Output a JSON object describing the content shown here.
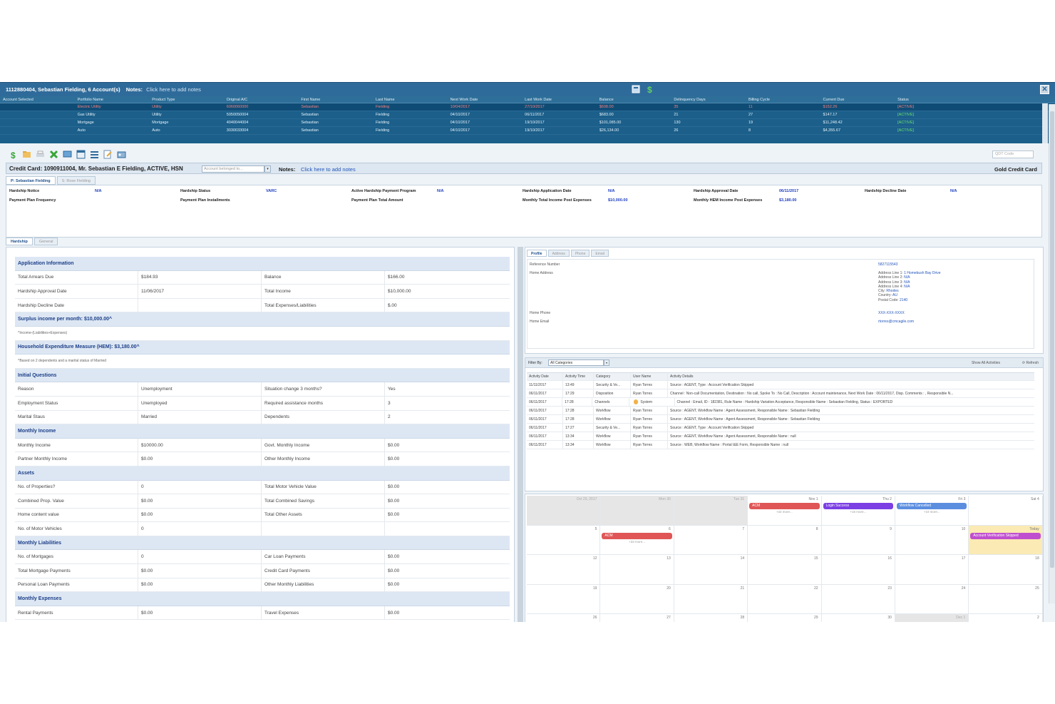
{
  "topbar": {
    "account": "1112880404, Sebastian Fielding, 6 Account(s)",
    "notes_label": "Notes:",
    "notes_link": "Click here to add notes",
    "close": "✕"
  },
  "accounts": {
    "headers": [
      "Account Selected",
      "Portfolio Name",
      "Product Type",
      "Original A/C",
      "First Name",
      "Last Name",
      "Next Work Date",
      "Last Work Date",
      "Balance",
      "Delinquency Days",
      "Billing Cycle",
      "Current Due",
      "Status"
    ],
    "rows": [
      [
        "",
        "Electric Utility",
        "Utility",
        "6060060000",
        "Sebastian",
        "Fielding",
        "10/04/2017",
        "27/10/2017",
        "$608.00",
        "35",
        "11",
        "$152.26",
        "[ACTIVE]"
      ],
      [
        "",
        "Gas Utility",
        "Utility",
        "5050050004",
        "Sebastian",
        "Fielding",
        "04/10/2017",
        "06/11/2017",
        "$683.00",
        "21",
        "27",
        "$147.17",
        "[ACTIVE]"
      ],
      [
        "",
        "Mortgage",
        "Mortgage",
        "4040044004",
        "Sebastian",
        "Fielding",
        "04/10/2017",
        "19/10/2017",
        "$101,085.00",
        "130",
        "19",
        "$11,248.42",
        "[ACTIVE]"
      ],
      [
        "",
        "Auto",
        "Auto",
        "3030033004",
        "Sebastian",
        "Fielding",
        "04/10/2017",
        "19/10/2017",
        "$26,134.00",
        "26",
        "8",
        "$4,355.67",
        "[ACTIVE]"
      ]
    ]
  },
  "toolbar": {
    "qdt_placeholder": "QDT Code"
  },
  "ccbar": {
    "title": "Credit Card: 1090911004, Mr. Sebastian E Fielding, ACTIVE, HSN",
    "dropdown": "Account belonged to...",
    "notes_label": "Notes:",
    "notes_link": "Click here to add notes",
    "card_type": "Gold Credit Card"
  },
  "person_tabs": [
    "P: Sebastian Fielding",
    "S: Rose Fielding"
  ],
  "hardship_summary": [
    {
      "k": "Hardship Notice",
      "v": "N/A"
    },
    {
      "k": "Hardship Status",
      "v": "VARC"
    },
    {
      "k": "Active Hardship Payment Program",
      "v": "N/A"
    },
    {
      "k": "Hardship Application Date",
      "v": "N/A"
    },
    {
      "k": "Hardship Approval Date",
      "v": "06/11/2017"
    },
    {
      "k": "Hardship Decline Date",
      "v": "N/A"
    },
    {
      "k": "Payment Plan Frequency",
      "v": ""
    },
    {
      "k": "Payment Plan Installments",
      "v": ""
    },
    {
      "k": "Payment Plan Total Amount",
      "v": ""
    },
    {
      "k": "Monthly Total Income Post Expenses",
      "v": "$10,000.00"
    },
    {
      "k": "Monthly HEM Income Post Expenses",
      "v": "$3,180.00"
    },
    {
      "k": "",
      "v": ""
    }
  ],
  "lower_tabs": [
    "Hardship",
    "General"
  ],
  "application": {
    "rows": [
      {
        "type": "section",
        "text": "Application Information"
      },
      {
        "type": "row",
        "cells": [
          "Total Arrears Due",
          "$184.93",
          "Balance",
          "$166.00"
        ]
      },
      {
        "type": "row",
        "cells": [
          "Hardship Approval Date",
          "11/06/2017",
          "Total Income",
          "$10,000.00"
        ]
      },
      {
        "type": "row",
        "cells": [
          "Hardship Decline Date",
          "",
          "Total Expenses/Liabilities",
          "$.00"
        ]
      },
      {
        "type": "section",
        "text": "Surplus income per month: $10,000.00^"
      },
      {
        "type": "note",
        "text": "^Income-(Liabilities+Expenses)"
      },
      {
        "type": "section",
        "text": "Household Expenditure Measure (HEM): $3,180.00^"
      },
      {
        "type": "note",
        "text": "^Based on 2 dependents and a marital status of Married"
      },
      {
        "type": "section",
        "text": "Initial Questions"
      },
      {
        "type": "row",
        "cells": [
          "Reason",
          "Unemployment",
          "Situation change 3 months?",
          "Yes"
        ]
      },
      {
        "type": "row",
        "cells": [
          "Employment Status",
          "Unemployed",
          "Required assistance months",
          "3"
        ]
      },
      {
        "type": "row",
        "cells": [
          "Marital Staus",
          "Married",
          "Dependents",
          "2"
        ]
      },
      {
        "type": "section",
        "text": "Monthly Income"
      },
      {
        "type": "row",
        "cells": [
          "Monthly Income",
          "$10000.00",
          "Govt. Monthly Income",
          "$0.00"
        ]
      },
      {
        "type": "row",
        "cells": [
          "Partner Monthly Income",
          "$0.00",
          "Other Monthly Income",
          "$0.00"
        ]
      },
      {
        "type": "section",
        "text": "Assets"
      },
      {
        "type": "row",
        "cells": [
          "No. of Properties?",
          "0",
          "Total Motor Vehicle Value",
          "$0.00"
        ]
      },
      {
        "type": "row",
        "cells": [
          "Combined Prop. Value",
          "$0.00",
          "Total Combined Savings",
          "$0.00"
        ]
      },
      {
        "type": "row",
        "cells": [
          "Home content value",
          "$0.00",
          "Total Other Assets",
          "$0.00"
        ]
      },
      {
        "type": "row",
        "cells": [
          "No. of Motor Vehicles",
          "0",
          "",
          ""
        ]
      },
      {
        "type": "section",
        "text": "Monthly Liabilities"
      },
      {
        "type": "row",
        "cells": [
          "No. of Mortgages",
          "0",
          "Car Loan Payments",
          "$0.00"
        ]
      },
      {
        "type": "row",
        "cells": [
          "Total Mortgage Payments",
          "$0.00",
          "Credit Card Payments",
          "$0.00"
        ]
      },
      {
        "type": "row",
        "cells": [
          "Personal Loan Payments",
          "$0.00",
          "Other Monthly Liabilities",
          "$0.00"
        ]
      },
      {
        "type": "section",
        "text": "Monthly Expenses"
      },
      {
        "type": "row",
        "cells": [
          "Rental Payments",
          "$0.00",
          "Travel Expenses",
          "$0.00"
        ]
      }
    ]
  },
  "profile": {
    "tabs": [
      "Profile",
      "Address",
      "Phone",
      "Email"
    ],
    "reference_label": "Reference Number",
    "reference_value": "5827115543",
    "home_address_label": "Home Address",
    "address": [
      {
        "k": "Address Line 1:",
        "v": "1 Homebush Bay Drive"
      },
      {
        "k": "Address Line 2:",
        "v": "N/A"
      },
      {
        "k": "Address Line 3:",
        "v": "N/A"
      },
      {
        "k": "Address Line 4:",
        "v": "N/A"
      },
      {
        "k": "City:",
        "v": "Rhodes"
      },
      {
        "k": "Country:",
        "v": "AU"
      },
      {
        "k": "Postal Code:",
        "v": "2140"
      }
    ],
    "home_phone_label": "Home Phone",
    "home_phone_value": "XXX-XXX-XXXX",
    "home_email_label": "Home Email",
    "home_email_value": "rtorres@cmcagile.com"
  },
  "activities": {
    "filter_label": "Filter By:",
    "filter_value": "All Categories",
    "show_all": "Show All Activities",
    "refresh": "Refresh",
    "headers": [
      "Activity Date",
      "Activity Time",
      "Category",
      "User Name",
      "Activity Details"
    ],
    "rows": [
      [
        "11/11/2017",
        "13:49",
        "Security & Ve...",
        "Ryan Torres",
        "Source : AGENT, Type : Account Verification Skipped"
      ],
      [
        "06/11/2017",
        "17:29",
        "Disposition",
        "Ryan Torres",
        "Channel : Non-call Documentation, Destination : No call, Spoke To : No Call, Description : Account maintenance, Next Work Date : 06/11/2017, Disp. Comments : , Responsible N..."
      ],
      [
        "06/11/2017",
        "17:28",
        "Channels",
        "System",
        "Channel : Email, ID : 182381, Rule Name : Hardship Variation Acceptance, Responsible Name : Sebastian Fielding, Status : EXPORTED"
      ],
      [
        "06/11/2017",
        "17:28",
        "Workflow",
        "Ryan Torres",
        "Source : AGENT, Workflow Name : Agent Assessment, Responsible Name : Sebastian Fielding"
      ],
      [
        "06/11/2017",
        "17:28",
        "Workflow",
        "Ryan Torres",
        "Source : AGENT, Workflow Name : Agent Assessment, Responsible Name : Sebastian Fielding"
      ],
      [
        "06/11/2017",
        "17:27",
        "Security & Ve...",
        "Ryan Torres",
        "Source : AGENT, Type : Account Verification Skipped"
      ],
      [
        "06/11/2017",
        "13:34",
        "Workflow",
        "Ryan Torres",
        "Source : AGENT, Workflow Name : Agent Assessment, Responsible Name : null"
      ],
      [
        "06/11/2017",
        "13:34",
        "Workflow",
        "Ryan Torres",
        "Source : WEB, Workflow Name : Portal I&E Form, Responsible Name : null"
      ]
    ]
  },
  "calendar": {
    "cells": [
      {
        "d": "Oct 29, 2017",
        "gray": true
      },
      {
        "d": "Mon 30",
        "gray": true
      },
      {
        "d": "Tue 31",
        "gray": true
      },
      {
        "d": "Nov 1",
        "ev": "ACM",
        "evc": "#e05656",
        "more": "+22 more..."
      },
      {
        "d": "Thu 2",
        "ev": "Login Success",
        "evc": "#7b3fe4",
        "more": "+15 more..."
      },
      {
        "d": "Fri 3",
        "ev": "Workflow Cancelled",
        "evc": "#5c8ee0",
        "more": "+10 more..."
      },
      {
        "d": "Sat 4"
      },
      {
        "d": "5"
      },
      {
        "d": "6",
        "ev": "ACM",
        "evc": "#e05656",
        "more": "+33 more..."
      },
      {
        "d": "7"
      },
      {
        "d": "8"
      },
      {
        "d": "9"
      },
      {
        "d": "10"
      },
      {
        "d": "Today",
        "today": true,
        "ev": "Account Verification Skipped",
        "evc": "#c04fd0"
      },
      {
        "d": "12"
      },
      {
        "d": "13"
      },
      {
        "d": "14"
      },
      {
        "d": "15"
      },
      {
        "d": "16"
      },
      {
        "d": "17"
      },
      {
        "d": "18"
      },
      {
        "d": "19"
      },
      {
        "d": "20"
      },
      {
        "d": "21"
      },
      {
        "d": "22"
      },
      {
        "d": "23"
      },
      {
        "d": "24"
      },
      {
        "d": "25"
      },
      {
        "d": "26"
      },
      {
        "d": "27"
      },
      {
        "d": "28"
      },
      {
        "d": "29"
      },
      {
        "d": "30"
      },
      {
        "d": "Dec 1",
        "gray": true
      },
      {
        "d": "2"
      }
    ]
  }
}
